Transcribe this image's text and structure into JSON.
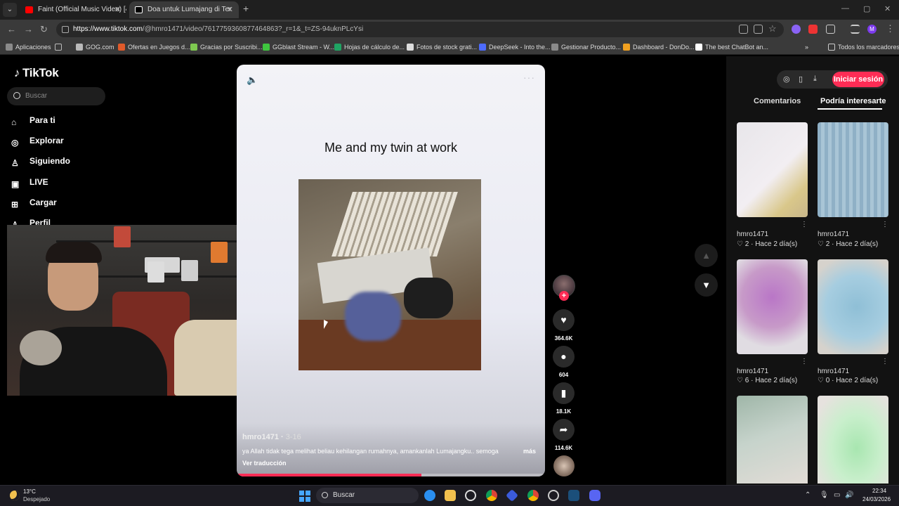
{
  "browser": {
    "tabs": [
      {
        "title": "Faint (Official Music Video) [4K"
      },
      {
        "title": "Doa untuk Lumajang di Ter"
      }
    ],
    "url": {
      "host": "https://www.tiktok.com",
      "path": "/@hmro1471/video/7617759360877464863?_r=1&_t=ZS-94uknPLcYsi"
    },
    "bookmarks": [
      {
        "label": "Aplicaciones",
        "color": "#8a8a8a"
      },
      {
        "label": "GOG.com",
        "color": "#b9b9b9"
      },
      {
        "label": "Ofertas en Juegos d...",
        "color": "#e05a2a"
      },
      {
        "label": "Gracias por Suscribi...",
        "color": "#7ec850"
      },
      {
        "label": "GGblast Stream - W...",
        "color": "#3fc63f"
      },
      {
        "label": "Hojas de cálculo de...",
        "color": "#1fa463"
      },
      {
        "label": "Fotos de stock grati...",
        "color": "#dddddd"
      },
      {
        "label": "DeepSeek - Into the...",
        "color": "#4d6bfe"
      },
      {
        "label": "Gestionar Producto...",
        "color": "#8a8a8a"
      },
      {
        "label": "Dashboard - DonDo...",
        "color": "#f0a020"
      },
      {
        "label": "The best ChatBot an...",
        "color": "#ffffff"
      }
    ],
    "bookmarks_all": "Todos los marcadores"
  },
  "sidebar": {
    "logo": "TikTok",
    "search_placeholder": "Buscar",
    "items": [
      {
        "label": "Para ti",
        "icon": "home-icon"
      },
      {
        "label": "Explorar",
        "icon": "compass-icon"
      },
      {
        "label": "Siguiendo",
        "icon": "following-icon"
      },
      {
        "label": "LIVE",
        "icon": "live-icon"
      },
      {
        "label": "Cargar",
        "icon": "upload-icon"
      },
      {
        "label": "Perfil",
        "icon": "profile-icon"
      }
    ]
  },
  "video": {
    "caption": "Me and my twin at work",
    "author": "hmro1471",
    "date": "3-16",
    "description": "ya Allah tidak tega melihat beliau kehilangan rumahnya, amankanlah Lumajangku.. semoga",
    "more_label": "más",
    "translate_label": "Ver traducción",
    "progress": 0.6
  },
  "actions": {
    "likes": "364.6K",
    "comments": "604",
    "saves": "18.1K",
    "shares": "114.6K"
  },
  "right_panel": {
    "login_label": "Iniciar sesión",
    "tabs": [
      "Comentarios",
      "Podría interesarte"
    ],
    "thumbs": [
      {
        "author": "hmro1471",
        "likes": "2",
        "time": "Hace 2 día(s)"
      },
      {
        "author": "hmro1471",
        "likes": "2",
        "time": "Hace 2 día(s)"
      },
      {
        "author": "hmro1471",
        "likes": "6",
        "time": "Hace 2 día(s)"
      },
      {
        "author": "hmro1471",
        "likes": "0",
        "time": "Hace 2 día(s)"
      }
    ]
  },
  "taskbar": {
    "temp": "13°C",
    "weather": "Despejado",
    "search_placeholder": "Buscar",
    "time": "22:34",
    "date": "24/03/2026"
  },
  "colors": {
    "accent": "#fe2c55"
  }
}
